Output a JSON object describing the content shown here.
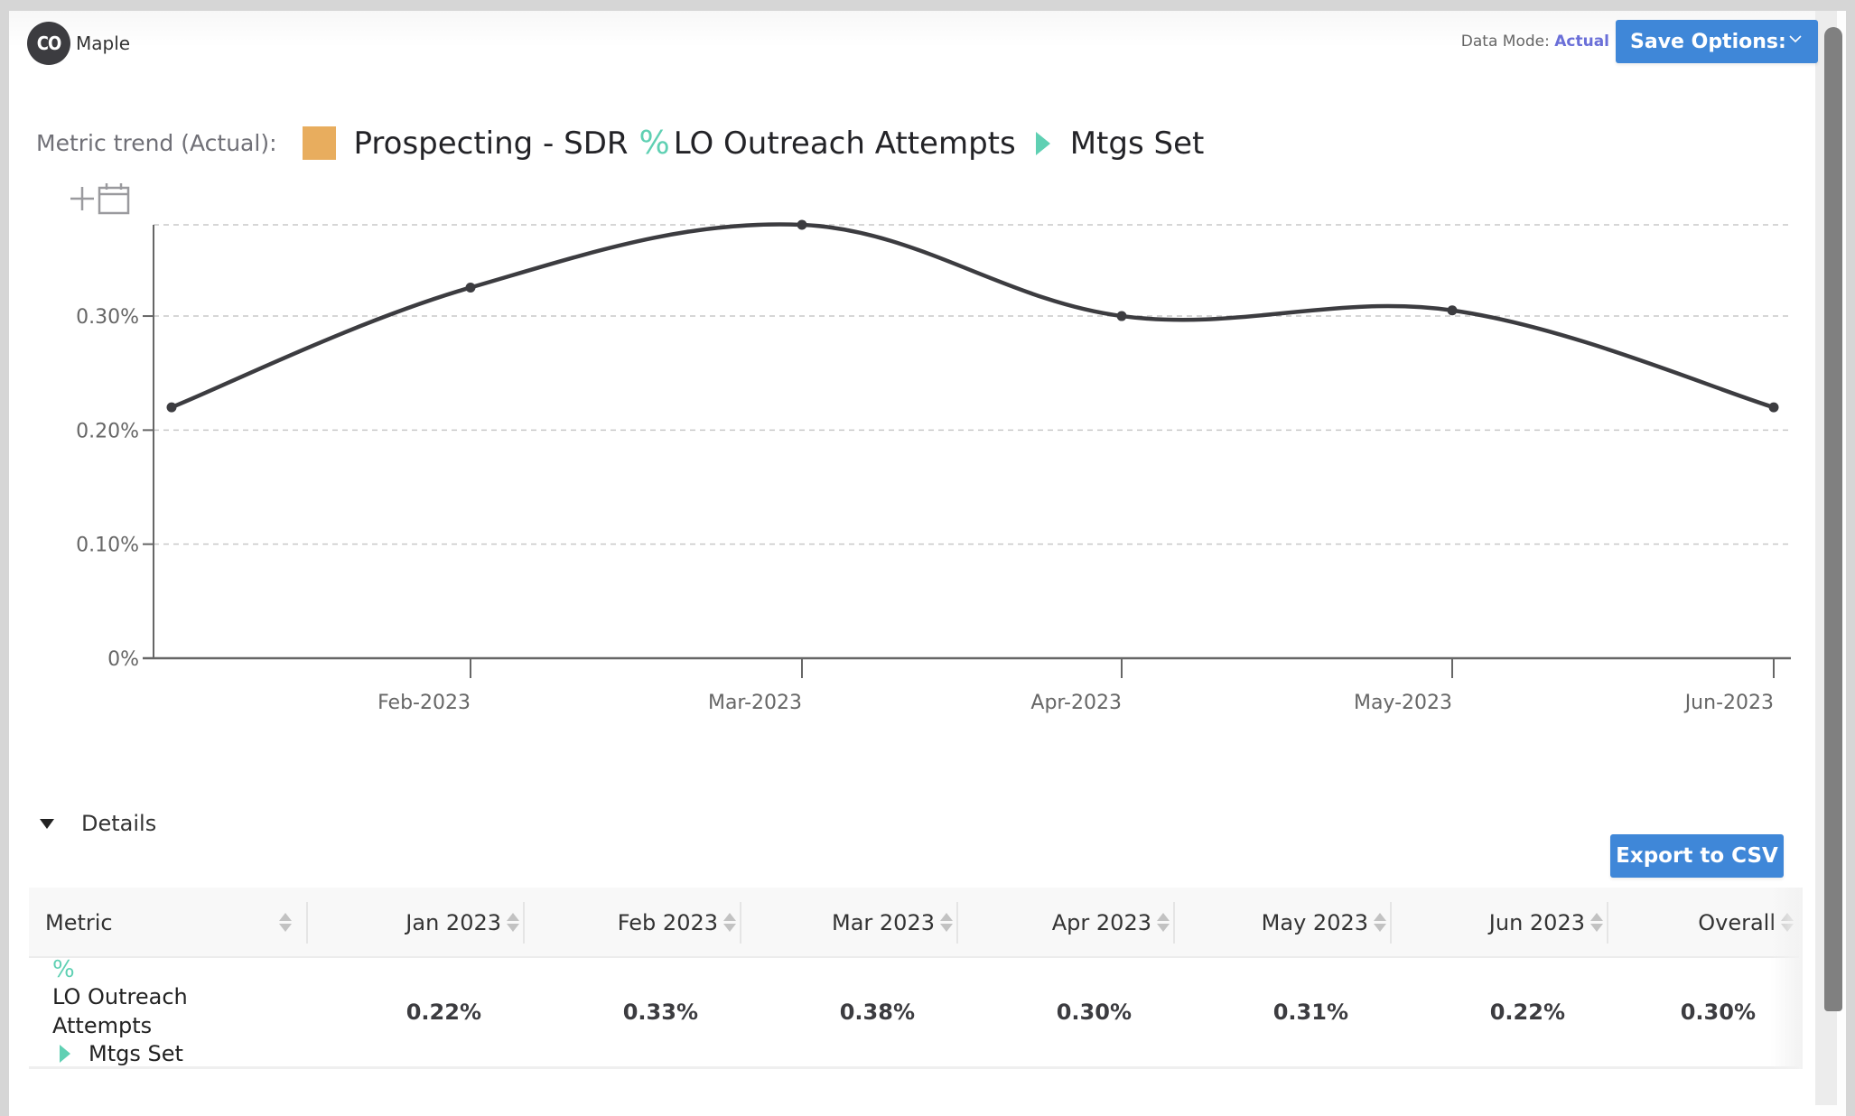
{
  "brand": {
    "avatar_initials": "CO",
    "name": "Maple"
  },
  "header": {
    "data_mode_label": "Data Mode:",
    "data_mode_value": "Actual",
    "save_options_label": "Save Options:",
    "save_chevron_icon": "chevron-down-icon"
  },
  "trend": {
    "label": "Metric trend (Actual):",
    "group_color": "#e8ad5e",
    "group_name": "Prospecting - SDR",
    "pct_icon": "%",
    "metric_numerator": "LO Outreach Attempts",
    "metric_denominator": "Mtgs Set",
    "accent_color": "#5fd0b3"
  },
  "tools": {
    "add_icon": "plus-icon",
    "calendar_icon": "calendar-icon"
  },
  "chart_data": {
    "type": "line",
    "title": "Metric trend (Actual): Prospecting - SDR % LO Outreach Attempts ▶ Mtgs Set",
    "x": [
      "Jan-2023",
      "Feb-2023",
      "Mar-2023",
      "Apr-2023",
      "May-2023",
      "Jun-2023"
    ],
    "x_tick_labels": [
      "Feb-2023",
      "Mar-2023",
      "Apr-2023",
      "May-2023",
      "Jun-2023"
    ],
    "series": [
      {
        "name": "LO Outreach Attempts / Mtgs Set",
        "values": [
          0.22,
          0.325,
          0.38,
          0.3,
          0.305,
          0.22
        ],
        "color": "#3c3c40"
      }
    ],
    "y_ticks": [
      0,
      0.1,
      0.2,
      0.3
    ],
    "y_tick_labels": [
      "0%",
      "0.10%",
      "0.20%",
      "0.30%"
    ],
    "ylim": [
      0,
      0.38
    ],
    "xlabel": "",
    "ylabel": "",
    "grid": true,
    "curve": "smooth"
  },
  "details": {
    "toggle_label": "Details",
    "export_label": "Export to CSV",
    "columns": [
      "Metric",
      "Jan 2023",
      "Feb 2023",
      "Mar 2023",
      "Apr 2023",
      "May 2023",
      "Jun 2023",
      "Overall"
    ],
    "rows": [
      {
        "pct_icon": "%",
        "metric_numerator": "LO Outreach Attempts",
        "metric_denominator": "Mtgs Set",
        "values": [
          "0.22%",
          "0.33%",
          "0.38%",
          "0.30%",
          "0.31%",
          "0.22%",
          "0.30%"
        ]
      }
    ]
  }
}
